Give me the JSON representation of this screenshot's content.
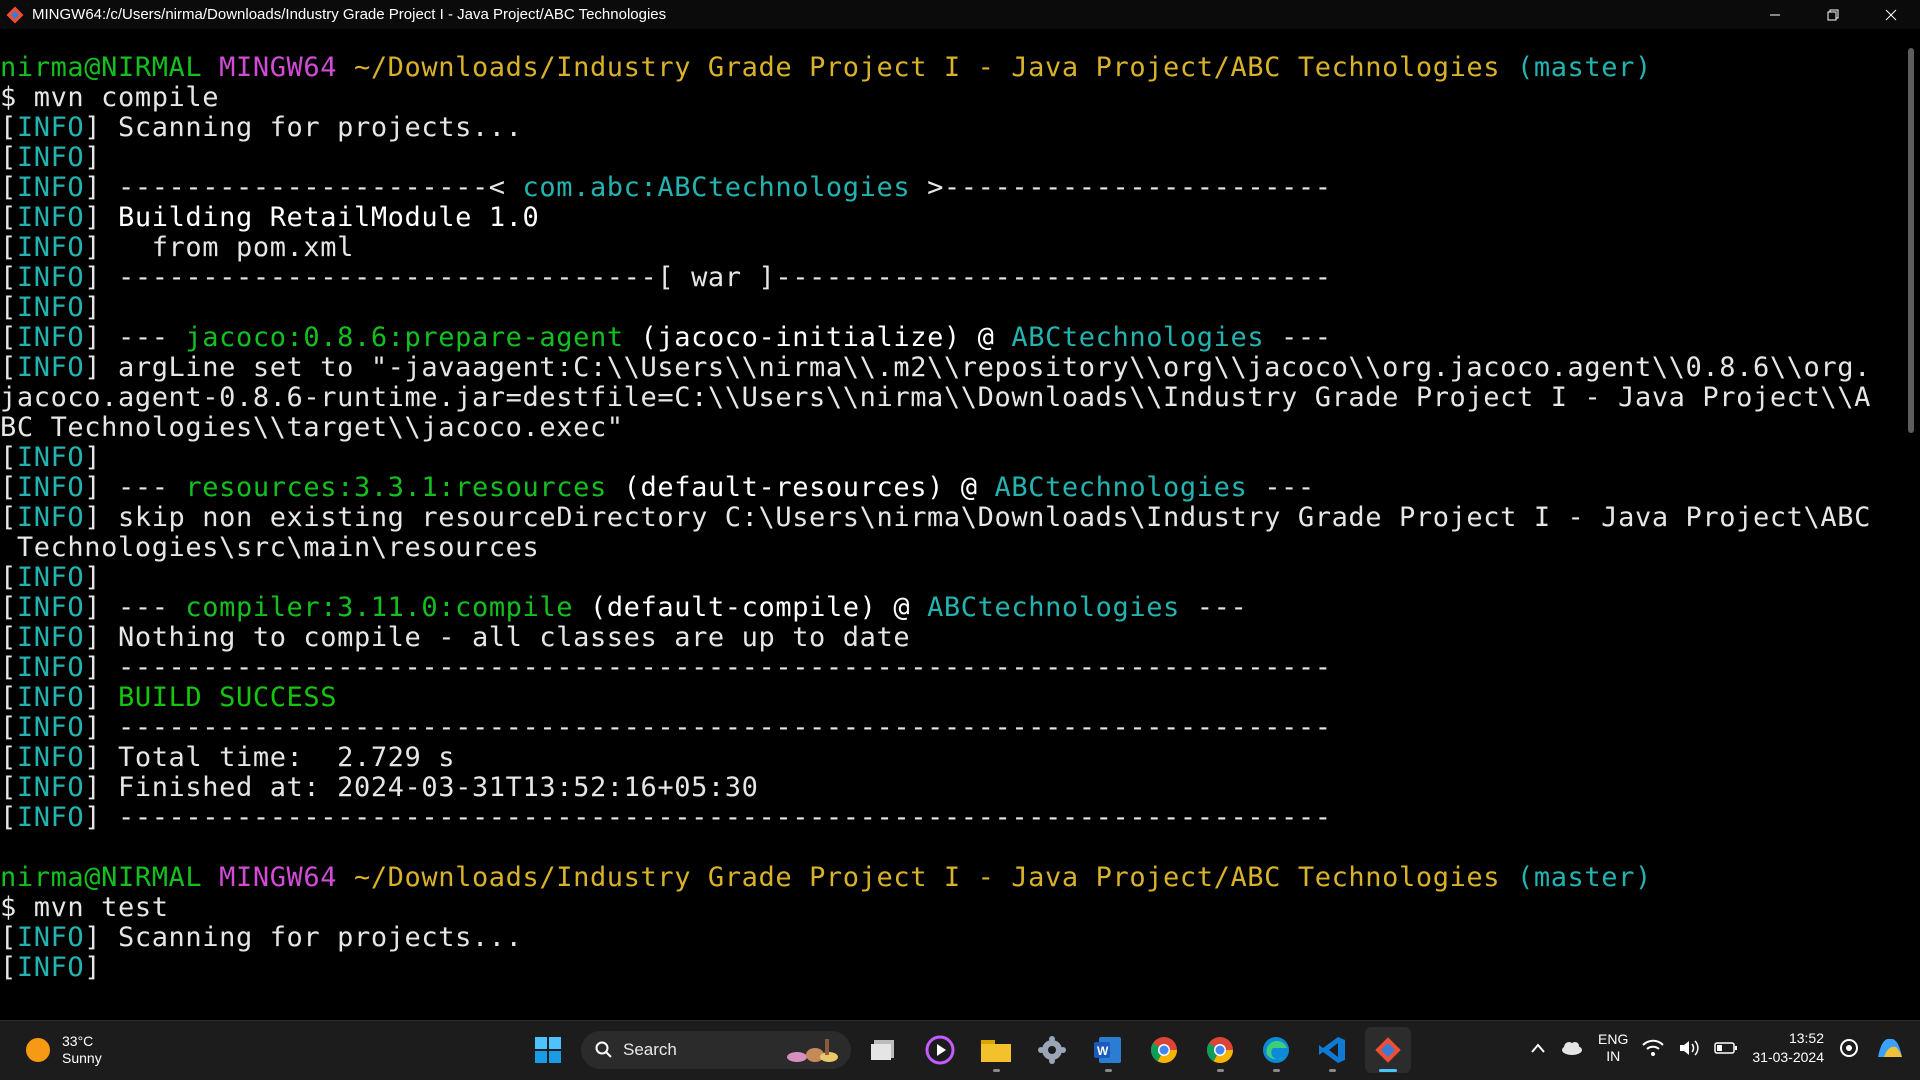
{
  "window": {
    "title": "MINGW64:/c/Users/nirma/Downloads/Industry Grade Project I - Java Project/ABC Technologies",
    "icons": [
      "git-bash-icon",
      "minimize-icon",
      "restore-icon",
      "close-icon"
    ]
  },
  "terminal": {
    "lines": [
      [
        {
          "t": "nirma@NIRMAL ",
          "c": "green"
        },
        {
          "t": "MINGW64 ",
          "c": "magenta"
        },
        {
          "t": "~/Downloads/Industry Grade Project I - Java Project/ABC Technologies",
          "c": "yellow"
        },
        {
          "t": " (master)",
          "c": "cyan"
        }
      ],
      [
        {
          "t": "$ mvn compile",
          "c": "default"
        }
      ],
      [
        {
          "t": "[",
          "c": "default"
        },
        {
          "t": "INFO",
          "c": "cyan"
        },
        {
          "t": "] Scanning for projects...",
          "c": "default"
        }
      ],
      [
        {
          "t": "[",
          "c": "default"
        },
        {
          "t": "INFO",
          "c": "cyan"
        },
        {
          "t": "]",
          "c": "default"
        }
      ],
      [
        {
          "t": "[",
          "c": "default"
        },
        {
          "t": "INFO",
          "c": "cyan"
        },
        {
          "t": "] ----------------------< ",
          "c": "default"
        },
        {
          "t": "com.abc:ABCtechnologies",
          "c": "cyan"
        },
        {
          "t": " >-----------------------",
          "c": "default"
        }
      ],
      [
        {
          "t": "[",
          "c": "default"
        },
        {
          "t": "INFO",
          "c": "cyan"
        },
        {
          "t": "] ",
          "c": "default"
        },
        {
          "t": "Building RetailModule 1.0",
          "c": "white"
        }
      ],
      [
        {
          "t": "[",
          "c": "default"
        },
        {
          "t": "INFO",
          "c": "cyan"
        },
        {
          "t": "]   from pom.xml",
          "c": "default"
        }
      ],
      [
        {
          "t": "[",
          "c": "default"
        },
        {
          "t": "INFO",
          "c": "cyan"
        },
        {
          "t": "] --------------------------------[ war ]---------------------------------",
          "c": "default"
        }
      ],
      [
        {
          "t": "[",
          "c": "default"
        },
        {
          "t": "INFO",
          "c": "cyan"
        },
        {
          "t": "]",
          "c": "default"
        }
      ],
      [
        {
          "t": "[",
          "c": "default"
        },
        {
          "t": "INFO",
          "c": "cyan"
        },
        {
          "t": "] --- ",
          "c": "default"
        },
        {
          "t": "jacoco:0.8.6:prepare-agent",
          "c": "green"
        },
        {
          "t": " (jacoco-initialize) @ ",
          "c": "white"
        },
        {
          "t": "ABCtechnologies",
          "c": "cyan"
        },
        {
          "t": " ---",
          "c": "default"
        }
      ],
      [
        {
          "t": "[",
          "c": "default"
        },
        {
          "t": "INFO",
          "c": "cyan"
        },
        {
          "t": "] argLine set to \"-javaagent:C:\\\\Users\\\\nirma\\\\.m2\\\\repository\\\\org\\\\jacoco\\\\org.jacoco.agent\\\\0.8.6\\\\org.",
          "c": "default"
        }
      ],
      [
        {
          "t": "jacoco.agent-0.8.6-runtime.jar=destfile=C:\\\\Users\\\\nirma\\\\Downloads\\\\Industry Grade Project I - Java Project\\\\A",
          "c": "default"
        }
      ],
      [
        {
          "t": "BC Technologies\\\\target\\\\jacoco.exec\"",
          "c": "default"
        }
      ],
      [
        {
          "t": "[",
          "c": "default"
        },
        {
          "t": "INFO",
          "c": "cyan"
        },
        {
          "t": "]",
          "c": "default"
        }
      ],
      [
        {
          "t": "[",
          "c": "default"
        },
        {
          "t": "INFO",
          "c": "cyan"
        },
        {
          "t": "] --- ",
          "c": "default"
        },
        {
          "t": "resources:3.3.1:resources",
          "c": "green"
        },
        {
          "t": " (default-resources) @ ",
          "c": "white"
        },
        {
          "t": "ABCtechnologies",
          "c": "cyan"
        },
        {
          "t": " ---",
          "c": "default"
        }
      ],
      [
        {
          "t": "[",
          "c": "default"
        },
        {
          "t": "INFO",
          "c": "cyan"
        },
        {
          "t": "] skip non existing resourceDirectory C:\\Users\\nirma\\Downloads\\Industry Grade Project I - Java Project\\ABC",
          "c": "default"
        }
      ],
      [
        {
          "t": " Technologies\\src\\main\\resources",
          "c": "default"
        }
      ],
      [
        {
          "t": "[",
          "c": "default"
        },
        {
          "t": "INFO",
          "c": "cyan"
        },
        {
          "t": "]",
          "c": "default"
        }
      ],
      [
        {
          "t": "[",
          "c": "default"
        },
        {
          "t": "INFO",
          "c": "cyan"
        },
        {
          "t": "] --- ",
          "c": "default"
        },
        {
          "t": "compiler:3.11.0:compile",
          "c": "green"
        },
        {
          "t": " (default-compile) @ ",
          "c": "white"
        },
        {
          "t": "ABCtechnologies",
          "c": "cyan"
        },
        {
          "t": " ---",
          "c": "default"
        }
      ],
      [
        {
          "t": "[",
          "c": "default"
        },
        {
          "t": "INFO",
          "c": "cyan"
        },
        {
          "t": "] Nothing to compile - all classes are up to date",
          "c": "default"
        }
      ],
      [
        {
          "t": "[",
          "c": "default"
        },
        {
          "t": "INFO",
          "c": "cyan"
        },
        {
          "t": "] ------------------------------------------------------------------------",
          "c": "default"
        }
      ],
      [
        {
          "t": "[",
          "c": "default"
        },
        {
          "t": "INFO",
          "c": "cyan"
        },
        {
          "t": "] ",
          "c": "default"
        },
        {
          "t": "BUILD SUCCESS",
          "c": "bold-green"
        }
      ],
      [
        {
          "t": "[",
          "c": "default"
        },
        {
          "t": "INFO",
          "c": "cyan"
        },
        {
          "t": "] ------------------------------------------------------------------------",
          "c": "default"
        }
      ],
      [
        {
          "t": "[",
          "c": "default"
        },
        {
          "t": "INFO",
          "c": "cyan"
        },
        {
          "t": "] Total time:  2.729 s",
          "c": "default"
        }
      ],
      [
        {
          "t": "[",
          "c": "default"
        },
        {
          "t": "INFO",
          "c": "cyan"
        },
        {
          "t": "] Finished at: 2024-03-31T13:52:16+05:30",
          "c": "default"
        }
      ],
      [
        {
          "t": "[",
          "c": "default"
        },
        {
          "t": "INFO",
          "c": "cyan"
        },
        {
          "t": "] ------------------------------------------------------------------------",
          "c": "default"
        }
      ],
      [
        {
          "t": "",
          "c": "default"
        }
      ],
      [
        {
          "t": "nirma@NIRMAL ",
          "c": "green"
        },
        {
          "t": "MINGW64 ",
          "c": "magenta"
        },
        {
          "t": "~/Downloads/Industry Grade Project I - Java Project/ABC Technologies",
          "c": "yellow"
        },
        {
          "t": " (master)",
          "c": "cyan"
        }
      ],
      [
        {
          "t": "$ mvn test",
          "c": "default"
        }
      ],
      [
        {
          "t": "[",
          "c": "default"
        },
        {
          "t": "INFO",
          "c": "cyan"
        },
        {
          "t": "] Scanning for projects...",
          "c": "default"
        }
      ],
      [
        {
          "t": "[",
          "c": "default"
        },
        {
          "t": "INFO",
          "c": "cyan"
        },
        {
          "t": "]",
          "c": "default"
        }
      ]
    ]
  },
  "taskbar": {
    "weather": {
      "temp": "33°C",
      "condition": "Sunny"
    },
    "search_label": "Search",
    "apps": [
      {
        "name": "start-button",
        "active": false
      },
      {
        "name": "task-view",
        "active": false
      },
      {
        "name": "media-player",
        "active": false
      },
      {
        "name": "file-explorer",
        "active": false
      },
      {
        "name": "settings",
        "active": false
      },
      {
        "name": "word",
        "active": false
      },
      {
        "name": "chrome",
        "active": false
      },
      {
        "name": "chrome-profile",
        "active": false
      },
      {
        "name": "edge",
        "active": false
      },
      {
        "name": "vscode",
        "active": false
      },
      {
        "name": "git-bash",
        "active": true
      }
    ],
    "tray": {
      "lang_line1": "ENG",
      "lang_line2": "IN",
      "time": "13:52",
      "date": "31-03-2024"
    }
  },
  "colors": {
    "green": "#13c01f",
    "magenta": "#d04cd4",
    "yellow": "#d8b22a",
    "cyan": "#23b3b0",
    "white": "#ffffff",
    "default": "#e6e6e6"
  }
}
